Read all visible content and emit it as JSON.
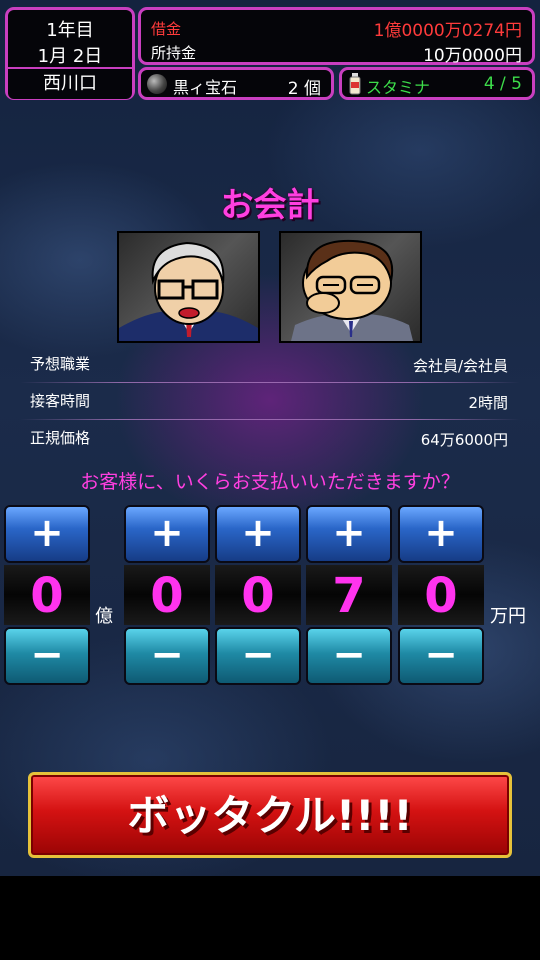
{
  "status": {
    "year": "1年目",
    "date": "1月 2日",
    "location": "西川口",
    "debt_label": "借金",
    "debt_value": "1億0000万0274円",
    "money_label": "所持金",
    "money_value": "10万0000円",
    "gem_label": "黒ィ宝石",
    "gem_value": "2 個",
    "stamina_label": "スタミナ",
    "stamina_value": "4 / 5"
  },
  "title": "お会計",
  "info": {
    "rows": [
      {
        "label": "予想職業",
        "value": "会社員/会社員"
      },
      {
        "label": "接客時間",
        "value": "2時間"
      },
      {
        "label": "正規価格",
        "value": "64万6000円"
      }
    ]
  },
  "question": "お客様に、いくらお支払いいただきますか？",
  "price": {
    "plus": "+",
    "minus": "−",
    "oku_digit": "0",
    "oku_unit": "億",
    "man_digits": [
      "0",
      "0",
      "7",
      "0"
    ],
    "man_unit": "万円"
  },
  "submit_label": "ボッタクル!!!!",
  "colors": {
    "accent": "#c93fc0",
    "digit": "#ff33ee",
    "debt": "#ff3b3b",
    "stamina": "#3ddc4a"
  }
}
